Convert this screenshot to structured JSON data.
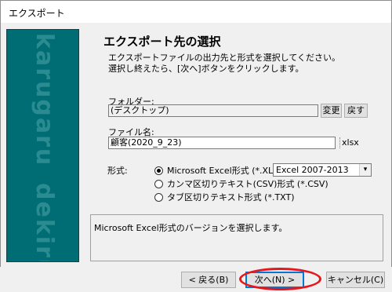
{
  "window": {
    "title": "エクスポート"
  },
  "side_panel": {
    "brand_top": "karugaru",
    "brand_bottom": "dekiru"
  },
  "header": {
    "title": "エクスポート先の選択",
    "description_line1": "エクスポートファイルの出力先と形式を選択してください。",
    "description_line2": "選択し終えたら、[次へ]ボタンをクリックします。"
  },
  "folder": {
    "label": "フォルダー:",
    "value": "(デスクトップ)",
    "change_label": "変更",
    "back_label": "戻す"
  },
  "filename": {
    "label": "ファイル名:",
    "value": "顧客(2020_9_23)",
    "extension": "xlsx"
  },
  "format": {
    "label": "形式:",
    "options": [
      {
        "label": "Microsoft Excel形式 (*.XLS)",
        "selected": true
      },
      {
        "label": "カンマ区切りテキスト(CSV)形式 (*.CSV)",
        "selected": false
      },
      {
        "label": "タブ区切りテキスト形式 (*.TXT)",
        "selected": false
      }
    ],
    "version_selected": "Excel 2007-2013"
  },
  "info": {
    "text": "Microsoft Excel形式のバージョンを選択します。"
  },
  "buttons": {
    "back": "< 戻る(B)",
    "next": "次へ(N) >",
    "cancel": "キャンセル(C)"
  },
  "colors": {
    "side_panel": "#006d75",
    "highlight": "#e8161b",
    "default_button": "#0078d7"
  }
}
